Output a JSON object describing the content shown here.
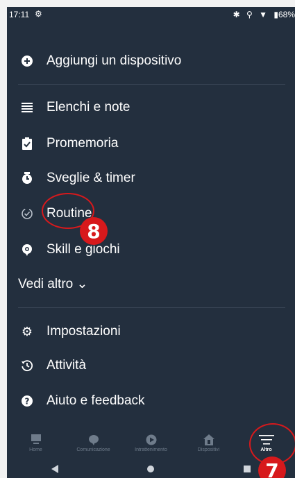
{
  "status_bar": {
    "time": "17:11",
    "battery": "68%"
  },
  "menu": {
    "add_device": "Aggiungi un dispositivo",
    "lists_notes": "Elenchi e note",
    "reminders": "Promemoria",
    "alarms_timers": "Sveglie & timer",
    "routines": "Routine",
    "skills_games": "Skill e giochi",
    "see_more": "Vedi altro ⌄",
    "settings": "Impostazioni",
    "activity": "Attività",
    "help_feedback": "Aiuto e feedback"
  },
  "bottom_nav": {
    "home": "Home",
    "communicate": "Comunicazione",
    "play": "Intrattenimento",
    "devices": "Dispositivi",
    "more": "Altro"
  },
  "annotations": {
    "badge_8": "8",
    "badge_7": "7"
  },
  "colors": {
    "background": "#232f3e",
    "annotation": "#d7191c",
    "inactive_nav": "#6f7c8b"
  }
}
